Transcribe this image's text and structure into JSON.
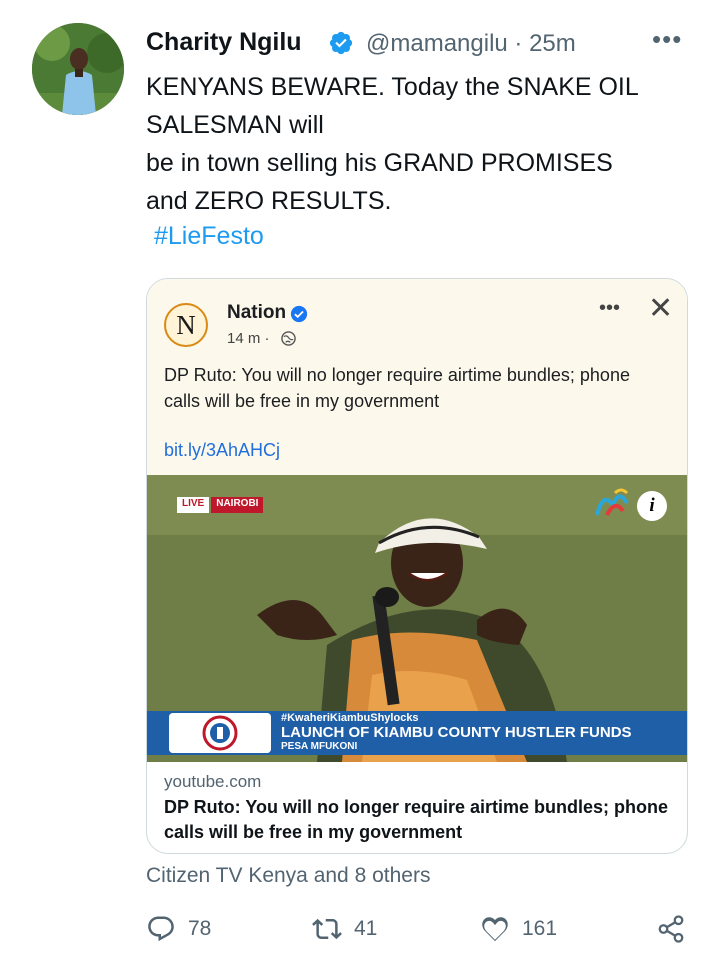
{
  "tweet": {
    "author_name": "Charity Ngilu",
    "handle_time": "@mamangilu · 25m",
    "text_lines": [
      "KENYANS BEWARE. Today the SNAKE OIL",
      "SALESMAN will",
      "be in town selling his GRAND PROMISES",
      "and ZERO RESULTS."
    ],
    "hashtag": "#LieFesto",
    "more_icon": "•••",
    "social_context": "Citizen TV Kenya and 8 others"
  },
  "card": {
    "page_name": "Nation",
    "page_logo_letter": "N",
    "post_time": "14 m ·",
    "post_text": "DP Ruto: You will no longer require airtime bundles; phone calls will be free in my government",
    "post_link": "bit.ly/3AhAHCj",
    "dots": "•••",
    "close": "✕",
    "video": {
      "live_label": "LIVE",
      "location_label": "NAIROBI",
      "info": "i",
      "ticker_hashtag": "#KwaheriKiambuShylocks",
      "ticker_headline": "LAUNCH OF KIAMBU COUNTY HUSTLER FUNDS",
      "ticker_sub": "PESA MFUKONI"
    },
    "domain": "youtube.com",
    "title": "DP Ruto: You will no longer require airtime bundles; phone calls will be free in my government"
  },
  "actions": {
    "reply_count": "78",
    "retweet_count": "41",
    "like_count": "161"
  },
  "colors": {
    "accent": "#1d9bf0",
    "muted": "#536471",
    "ticker_blue": "#1f5fa8",
    "live_red": "#c0182b"
  }
}
